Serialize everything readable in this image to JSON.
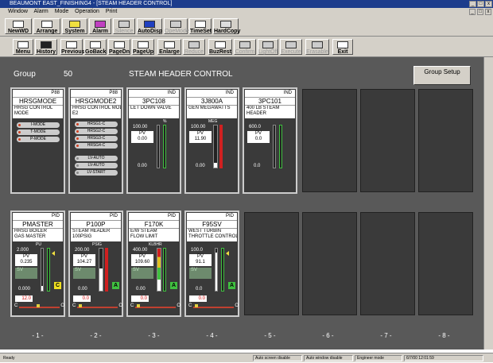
{
  "window": {
    "title": "BEAUMONT EAST_FINISHING4 - [STEAM HEADER CONTROL]"
  },
  "menu": {
    "items": [
      "Window",
      "Alarm",
      "Mode",
      "Operation",
      "Print"
    ]
  },
  "toolbar1": [
    "NewWD",
    "Arrange",
    "System",
    "Alarm",
    "Silence",
    "AutoDisp",
    "OpeMode",
    "TimeSet",
    "HardCopy"
  ],
  "toolbar2": [
    "Menu",
    "History",
    "Previous",
    "GoBack",
    "PageDn",
    "PageUp",
    "Enlarge",
    "Reduce",
    "BuzRest",
    "Confirm",
    "LightOff",
    "Execute",
    "Erasable",
    "Exit"
  ],
  "header": {
    "group_label": "Group",
    "group_num": "50",
    "title": "STEAM HEADER CONTROL",
    "setup": "Group Setup"
  },
  "top_panels": [
    {
      "tag": "P88",
      "name": "HRSGMODE",
      "desc1": "HRSG CONTROL",
      "desc2": "MODE",
      "modes": [
        "I-MODE",
        "T-MODE",
        "P-MODE"
      ]
    },
    {
      "tag": "P88",
      "name": "HRSGMODE2",
      "desc1": "HRSG CONTROL MOD",
      "desc2": "E2",
      "modes": [
        "HRSG1-C",
        "HRSG2-C",
        "HRSG3-C",
        "HRSG4-C",
        "LV-AUTO",
        "LV-AUTO",
        "LV-START"
      ]
    },
    {
      "tag": "IND",
      "name": "3PC108",
      "desc1": "LET DOWN VALVE",
      "desc2": "",
      "unit": "%",
      "hi": "100.00",
      "pv_label": "PV",
      "pv": "0.00",
      "lo": "0.00"
    },
    {
      "tag": "IND",
      "name": "3J800A",
      "desc1": "GEN MEGAWATTS",
      "desc2": "",
      "unit": "MEG",
      "hi": "100.00",
      "pv_label": "PV",
      "pv": "11.90",
      "lo": "0.00"
    },
    {
      "tag": "IND",
      "name": "3PC101",
      "desc1": "400 LB STEAM",
      "desc2": "HEADER",
      "unit": "",
      "hi": "600.0",
      "pv_label": "PV",
      "pv": "0.0",
      "lo": "0.0"
    }
  ],
  "bottom_panels": [
    {
      "tag": "PID",
      "name": "PMASTER",
      "desc1": "HRSG BOILER",
      "desc2": "GAS MASTER",
      "unit": "PU",
      "hi": "2.000",
      "pv_label": "PV",
      "pv": "0.235",
      "sv_label": "SV",
      "lo": "0.000",
      "status": "C",
      "status_color": "#f0e020",
      "out": "12.0",
      "c": "C",
      "o": "O"
    },
    {
      "tag": "PID",
      "name": "P100P",
      "desc1": "STEAM HEADER",
      "desc2": "100PSIG",
      "unit": "PSIG",
      "hi": "200.00",
      "pv_label": "PV",
      "pv": "104.27",
      "sv_label": "SV",
      "lo": "0.00",
      "status": "A",
      "status_color": "#40c040",
      "out": "0.0",
      "c": "C",
      "o": "O"
    },
    {
      "tag": "PID",
      "name": "F170K",
      "desc1": "E/W STEAM",
      "desc2": "FLOW LIMIT",
      "unit": "KLBHR",
      "hi": "400.00",
      "pv_label": "PV",
      "pv": "109.60",
      "sv_label": "SV",
      "lo": "0.00",
      "status": "A",
      "status_color": "#40c040",
      "out": "0.0",
      "c": "C",
      "o": "O"
    },
    {
      "tag": "PID",
      "name": "F95SV",
      "desc1": "WEST TURBIN",
      "desc2": "THROTTLE CONTROL",
      "unit": "",
      "hi": "100.0",
      "pv_label": "PV",
      "pv": "91.1",
      "sv_label": "SV",
      "lo": "0.0",
      "status": "A",
      "status_color": "#40c040",
      "out": "0.0",
      "c": "C",
      "o": "O"
    }
  ],
  "columns": [
    "- 1 -",
    "- 2 -",
    "- 3 -",
    "- 4 -",
    "- 5 -",
    "- 6 -",
    "- 7 -",
    "- 8 -"
  ],
  "statusbar": {
    "ready": "Ready",
    "s1": "Auto screen disable",
    "s2": "Auto window disable",
    "s3": "Engineer mode",
    "s4": "6/7/00 12:01:59"
  }
}
